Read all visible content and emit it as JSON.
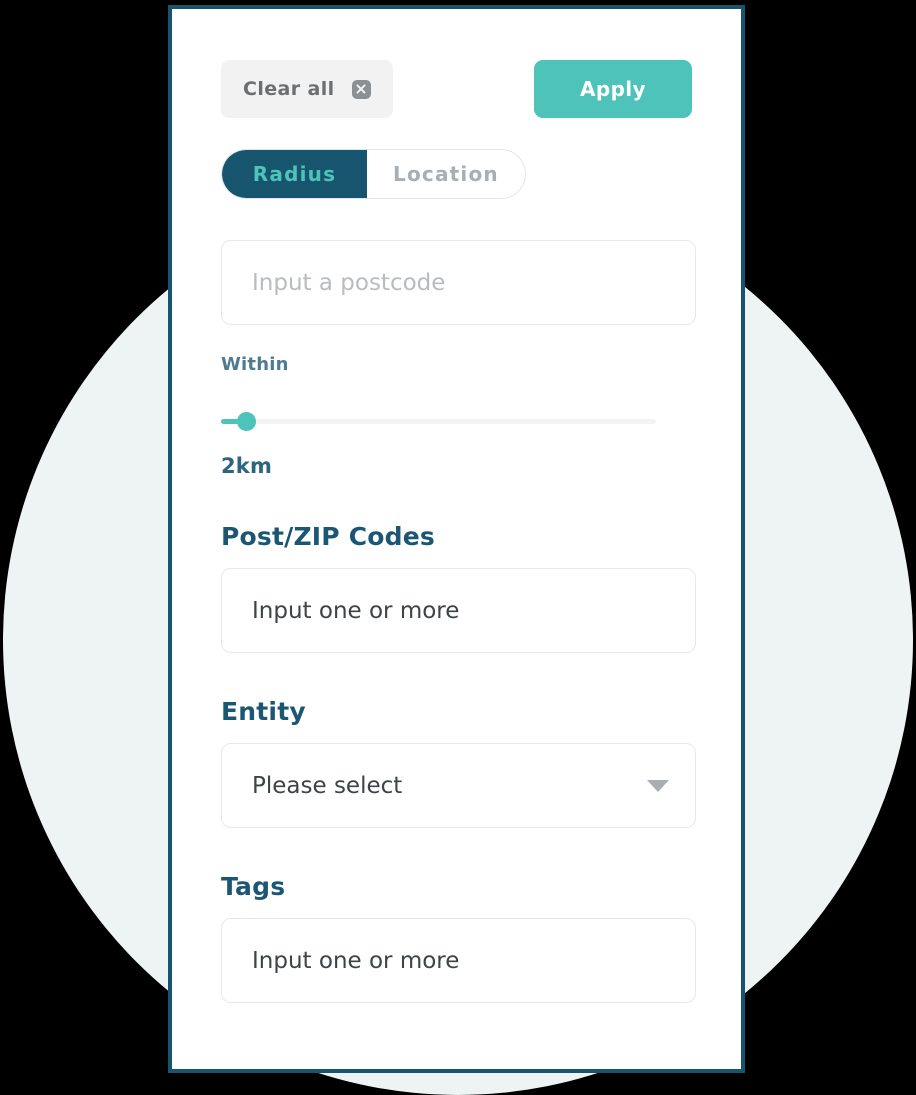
{
  "panel": {
    "actions": {
      "clear_all_label": "Clear all",
      "clear_icon": "clear-circle-icon",
      "apply_label": "Apply"
    },
    "tabs": [
      {
        "label": "Radius",
        "active": true
      },
      {
        "label": "Location",
        "active": false
      }
    ],
    "postcode_field": {
      "placeholder": "Input a postcode",
      "value": ""
    },
    "radius_slider": {
      "label": "Within",
      "value_label": "2km",
      "value": 2,
      "min": 0,
      "max": 50,
      "unit": "km"
    },
    "sections": [
      {
        "heading": "Post/ZIP Codes",
        "field_value": "Input one or more"
      },
      {
        "heading": "Entity",
        "select_value": "Please select",
        "chevron_icon": "chevron-down-icon"
      },
      {
        "heading": "Tags",
        "field_value": "Input one or more"
      }
    ]
  },
  "colors": {
    "accent_teal": "#4ec3ba",
    "navy": "#17556f",
    "heading_blue": "#1b5775",
    "panel_border": "#17556f",
    "background_circle": "#eef4f4"
  }
}
